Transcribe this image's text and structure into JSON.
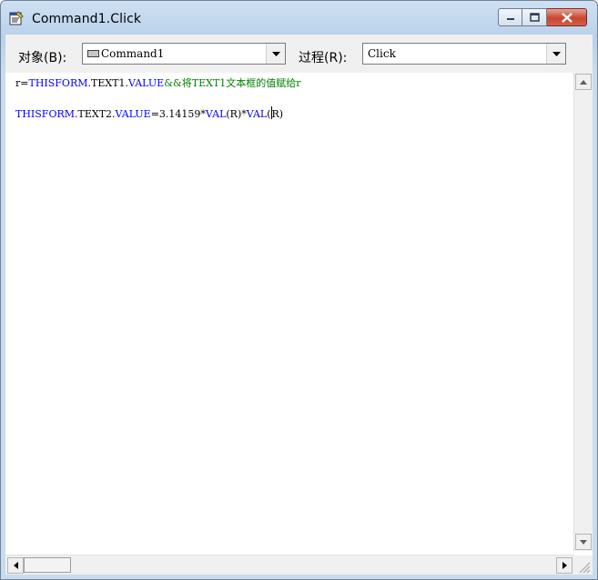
{
  "window": {
    "title": "Command1.Click",
    "icons": {
      "app": "code-window-icon",
      "minimize": "minimize-icon",
      "maximize": "maximize-icon",
      "close": "close-icon"
    }
  },
  "selectors": {
    "object_label": "对象(B):",
    "object_value": "Command1",
    "object_icon": "command-button-icon",
    "procedure_label": "过程(R):",
    "procedure_value": "Click"
  },
  "code": {
    "colors": {
      "keyword": "#0000ff",
      "text": "#000000",
      "comment": "#008000"
    },
    "lines": [
      {
        "t1": "r=",
        "k1": "THISFORM",
        "t2": ".TEXT1.",
        "k2": "VALUE",
        "c": "&&将TEXT1文本框的值赋给r"
      },
      {
        "k1": "THISFORM",
        "t1": ".TEXT2.",
        "k2": "VALUE",
        "t2": "=3.14159*",
        "k3": "VAL",
        "t3": "(R)*",
        "k4": "VAL",
        "t4": "(",
        "t5": "R)"
      }
    ]
  }
}
